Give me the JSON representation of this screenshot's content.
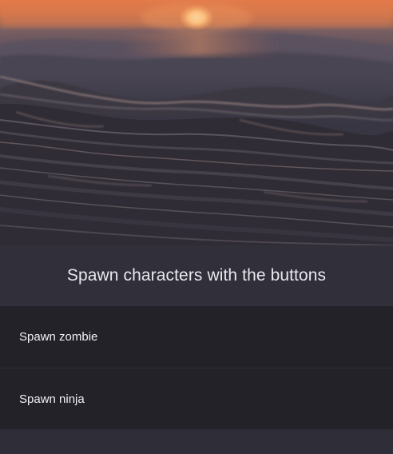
{
  "hero": {
    "image": "sunset-ocean-waves-photo"
  },
  "caption": {
    "text": "Spawn characters with the buttons"
  },
  "buttons": [
    {
      "label": "Spawn zombie"
    },
    {
      "label": "Spawn ninja"
    }
  ],
  "colors": {
    "background": "#2f2d38",
    "caption_bg": "#312f3a",
    "button_bg": "#232229",
    "text": "#f2f1f5"
  }
}
